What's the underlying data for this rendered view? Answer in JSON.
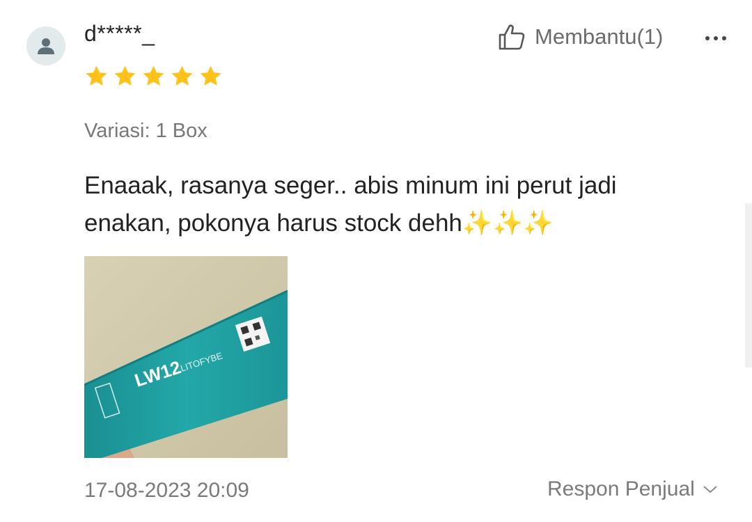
{
  "review": {
    "username": "d*****_",
    "rating": 5,
    "rating_max": 5,
    "helpful_label": "Membantu(1)",
    "variation": "Variasi: 1 Box",
    "text": "Enaaak, rasanya seger.. abis minum ini perut jadi enakan, pokonya harus stock dehh✨✨✨",
    "date": "17-08-2023 20:09",
    "seller_response_label": "Respon Penjual"
  },
  "photo": {
    "product_brand": "LW12",
    "product_name": "LITOFYBE"
  },
  "icons": {
    "avatar": "user-icon",
    "helpful": "thumbs-up-icon",
    "more": "more-options-icon",
    "star": "star-icon",
    "expand": "chevron-down-icon"
  },
  "colors": {
    "star": "#FFC21A",
    "text_primary": "#222222",
    "text_secondary": "#777777",
    "avatar_bg": "#E3EAEC",
    "avatar_fg": "#5F6F77",
    "product_teal": "#1E9FA0"
  }
}
